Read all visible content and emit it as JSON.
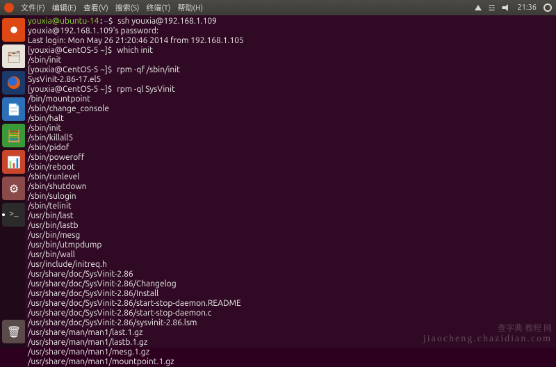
{
  "menubar": {
    "menus": [
      "文件(F)",
      "编辑(E)",
      "查看(V)",
      "搜索(S)",
      "终端(T)",
      "帮助(H)"
    ],
    "time": "21:36"
  },
  "launcher": {
    "items": [
      {
        "name": "dash",
        "icon": "ubuntu-icon"
      },
      {
        "name": "files",
        "icon": "folder-icon",
        "glyph": "🗂"
      },
      {
        "name": "firefox",
        "icon": "firefox-icon"
      },
      {
        "name": "writer",
        "icon": "document-icon",
        "glyph": "📄"
      },
      {
        "name": "calc",
        "icon": "spreadsheet-icon",
        "glyph": "🧮"
      },
      {
        "name": "impress",
        "icon": "presentation-icon",
        "glyph": "📊"
      },
      {
        "name": "updater",
        "icon": "gear-icon",
        "glyph": "⚙"
      },
      {
        "name": "terminal",
        "icon": "terminal-icon"
      },
      {
        "name": "trash",
        "icon": "trash-icon",
        "glyph": "🗑"
      }
    ]
  },
  "terminal": {
    "local_prompt_user": "youxia@ubuntu-14",
    "local_prompt_path": "~",
    "cmd_ssh": "ssh youxia@192.168.1.109",
    "pw_line": "youxia@192.168.1.109's password:",
    "last_login": "Last login: Mon May 26 21:20:46 2014 from 192.168.1.105",
    "remote_prompt": "[youxia@CentOS-5 ~]$",
    "cmd1": "which init",
    "out1": "/sbin/init",
    "cmd2": "rpm -qf /sbin/init",
    "out2": "SysVinit-2.86-17.el5",
    "cmd3": "rpm -ql SysVinit",
    "out3": [
      "/bin/mountpoint",
      "/sbin/change_console",
      "/sbin/halt",
      "/sbin/init",
      "/sbin/killall5",
      "/sbin/pidof",
      "/sbin/poweroff",
      "/sbin/reboot",
      "/sbin/runlevel",
      "/sbin/shutdown",
      "/sbin/sulogin",
      "/sbin/telinit",
      "/usr/bin/last",
      "/usr/bin/lastb",
      "/usr/bin/mesg",
      "/usr/bin/utmpdump",
      "/usr/bin/wall",
      "/usr/include/initreq.h",
      "/usr/share/doc/SysVinit-2.86",
      "/usr/share/doc/SysVinit-2.86/Changelog",
      "/usr/share/doc/SysVinit-2.86/Install",
      "/usr/share/doc/SysVinit-2.86/start-stop-daemon.README",
      "/usr/share/doc/SysVinit-2.86/start-stop-daemon.c",
      "/usr/share/doc/SysVinit-2.86/sysvinit-2.86.lsm",
      "/usr/share/man/man1/last.1.gz",
      "/usr/share/man/man1/lastb.1.gz",
      "/usr/share/man/man1/mesg.1.gz",
      "/usr/share/man/man1/mountpoint.1.gz"
    ]
  },
  "watermark": {
    "line1": "查字典 教程 网",
    "line2": "jiaocheng.chazidian.com"
  }
}
